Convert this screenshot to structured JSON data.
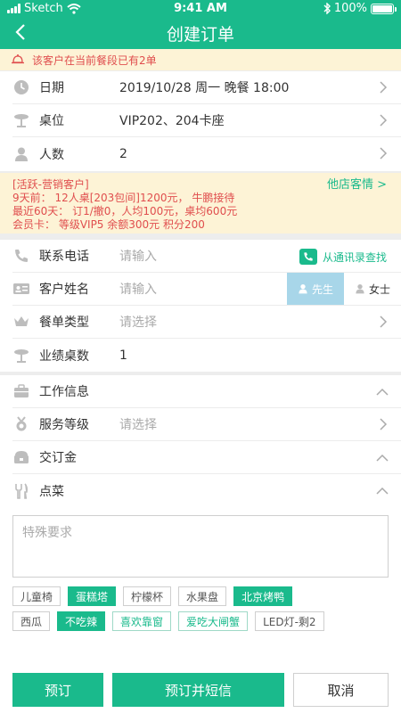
{
  "status_bar": {
    "carrier": "Sketch",
    "time": "9:41 AM",
    "battery": "100%"
  },
  "header": {
    "title": "创建订单"
  },
  "notice": {
    "text": "该客户在当前餐段已有2单"
  },
  "booking": [
    {
      "icon": "clock-icon",
      "label": "日期",
      "value": "2019/10/28 周一 晚餐 18:00"
    },
    {
      "icon": "table-icon",
      "label": "桌位",
      "value": "VIP202、204卡座"
    },
    {
      "icon": "person-icon",
      "label": "人数",
      "value": "2"
    }
  ],
  "member": {
    "line1": "[活跃-营销客户]",
    "line2": "9天前： 12人桌[203包间]1200元， 牛鹏接待",
    "line3": "最近60天： 订1/撤0，人均100元，桌均600元",
    "line4": "会员卡： 等级VIP5 余额300元 积分200",
    "other_store": "他店客情"
  },
  "customer": {
    "phone_label": "联系电话",
    "phone_placeholder": "请输入",
    "contacts_link": "从通讯录查找",
    "name_label": "客户姓名",
    "name_placeholder": "请输入",
    "gender_male": "先生",
    "gender_female": "女士",
    "menu_type_label": "餐单类型",
    "menu_type_placeholder": "请选择",
    "table_count_label": "业绩桌数",
    "table_count_value": "1"
  },
  "extra": {
    "work_info": "工作信息",
    "service_level": "服务等级",
    "service_level_placeholder": "请选择",
    "deposit": "交订金",
    "order_dishes": "点菜"
  },
  "special": {
    "placeholder": "特殊要求"
  },
  "tags_row1": [
    {
      "label": "儿童椅",
      "style": "plain"
    },
    {
      "label": "蛋糕塔",
      "style": "filled"
    },
    {
      "label": "柠檬杯",
      "style": "plain"
    },
    {
      "label": "水果盘",
      "style": "plain"
    },
    {
      "label": "北京烤鸭",
      "style": "filled"
    }
  ],
  "tags_row2": [
    {
      "label": "西瓜",
      "style": "plain"
    },
    {
      "label": "不吃辣",
      "style": "filled"
    },
    {
      "label": "喜欢靠窗",
      "style": "outline"
    },
    {
      "label": "爱吃大闸蟹",
      "style": "outline"
    },
    {
      "label": "LED灯-剩2",
      "style": "plain"
    }
  ],
  "buttons": {
    "reserve": "预订",
    "reserve_sms": "预订并短信",
    "cancel": "取消"
  },
  "colors": {
    "primary": "#1aba8c",
    "warning_bg": "#fdf3d6",
    "warning_text": "#e04e4e"
  }
}
